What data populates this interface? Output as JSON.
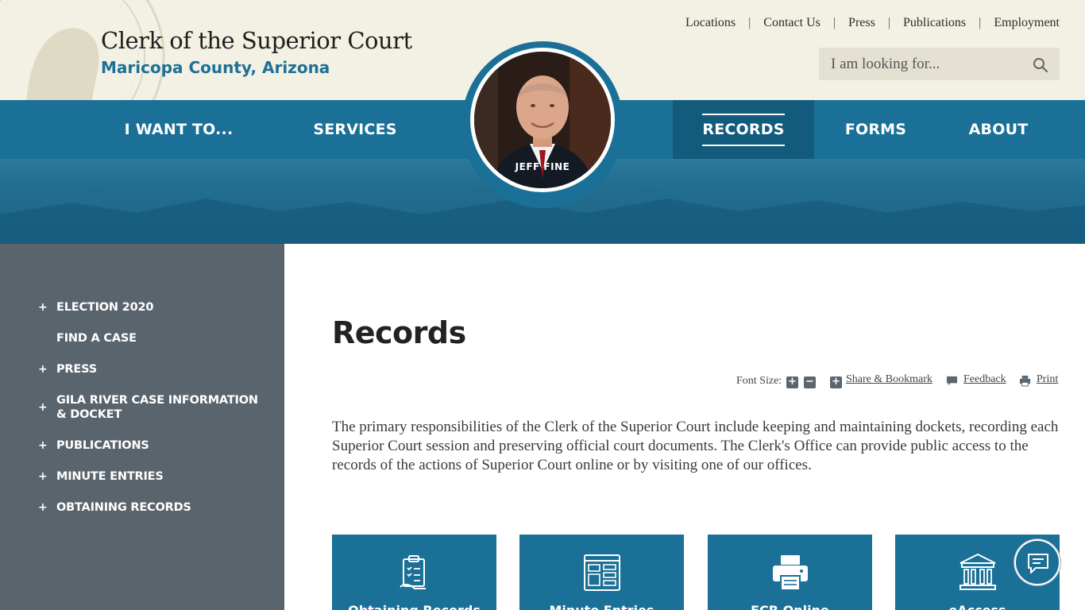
{
  "header": {
    "site_title": "Clerk of the Superior Court",
    "site_subtitle": "Maricopa County, Arizona"
  },
  "utility_links": [
    "Locations",
    "Contact Us",
    "Press",
    "Publications",
    "Employment"
  ],
  "utility_separator": "|",
  "search": {
    "placeholder": "I am looking for...",
    "icon": "search-icon"
  },
  "nav": {
    "items": [
      {
        "label": "I WANT TO...",
        "active": false
      },
      {
        "label": "SERVICES",
        "active": false
      },
      {
        "label": "RECORDS",
        "active": true
      },
      {
        "label": "FORMS",
        "active": false
      },
      {
        "label": "ABOUT",
        "active": false
      }
    ]
  },
  "portrait": {
    "name": "JEFF FINE"
  },
  "sidebar": {
    "items": [
      {
        "label": "ELECTION 2020",
        "expandable": true
      },
      {
        "label": "FIND A CASE",
        "expandable": false
      },
      {
        "label": "PRESS",
        "expandable": true
      },
      {
        "label": "GILA RIVER CASE INFORMATION & DOCKET",
        "expandable": true
      },
      {
        "label": "PUBLICATIONS",
        "expandable": true
      },
      {
        "label": "MINUTE ENTRIES",
        "expandable": true
      },
      {
        "label": "OBTAINING RECORDS",
        "expandable": true
      }
    ],
    "plus_symbol": "+"
  },
  "main": {
    "title": "Records",
    "tools": {
      "font_size_label": "Font Size:",
      "increase": "+",
      "decrease": "−",
      "share": "Share & Bookmark",
      "feedback": "Feedback",
      "print": "Print"
    },
    "intro": "The primary responsibilities of the Clerk of the Superior Court include keeping and maintaining dockets, recording each Superior Court session and preserving official court documents. The Clerk's Office can provide public access to the records of the actions of Superior Court online or by visiting one of our offices.",
    "cards": [
      {
        "label": "Obtaining Records",
        "icon": "clipboard-icon"
      },
      {
        "label": "Minute Entries",
        "icon": "document-form-icon"
      },
      {
        "label": "ECR Online",
        "icon": "printer-icon"
      },
      {
        "label": "eAccess",
        "icon": "courthouse-icon"
      }
    ]
  },
  "chat": {
    "icon": "chat-icon"
  },
  "colors": {
    "top_band": "#f3f1e4",
    "nav_blue": "#1a7096",
    "nav_active": "#125b7d",
    "sidebar": "#5a646d",
    "subtitle_blue": "#1e7196"
  }
}
